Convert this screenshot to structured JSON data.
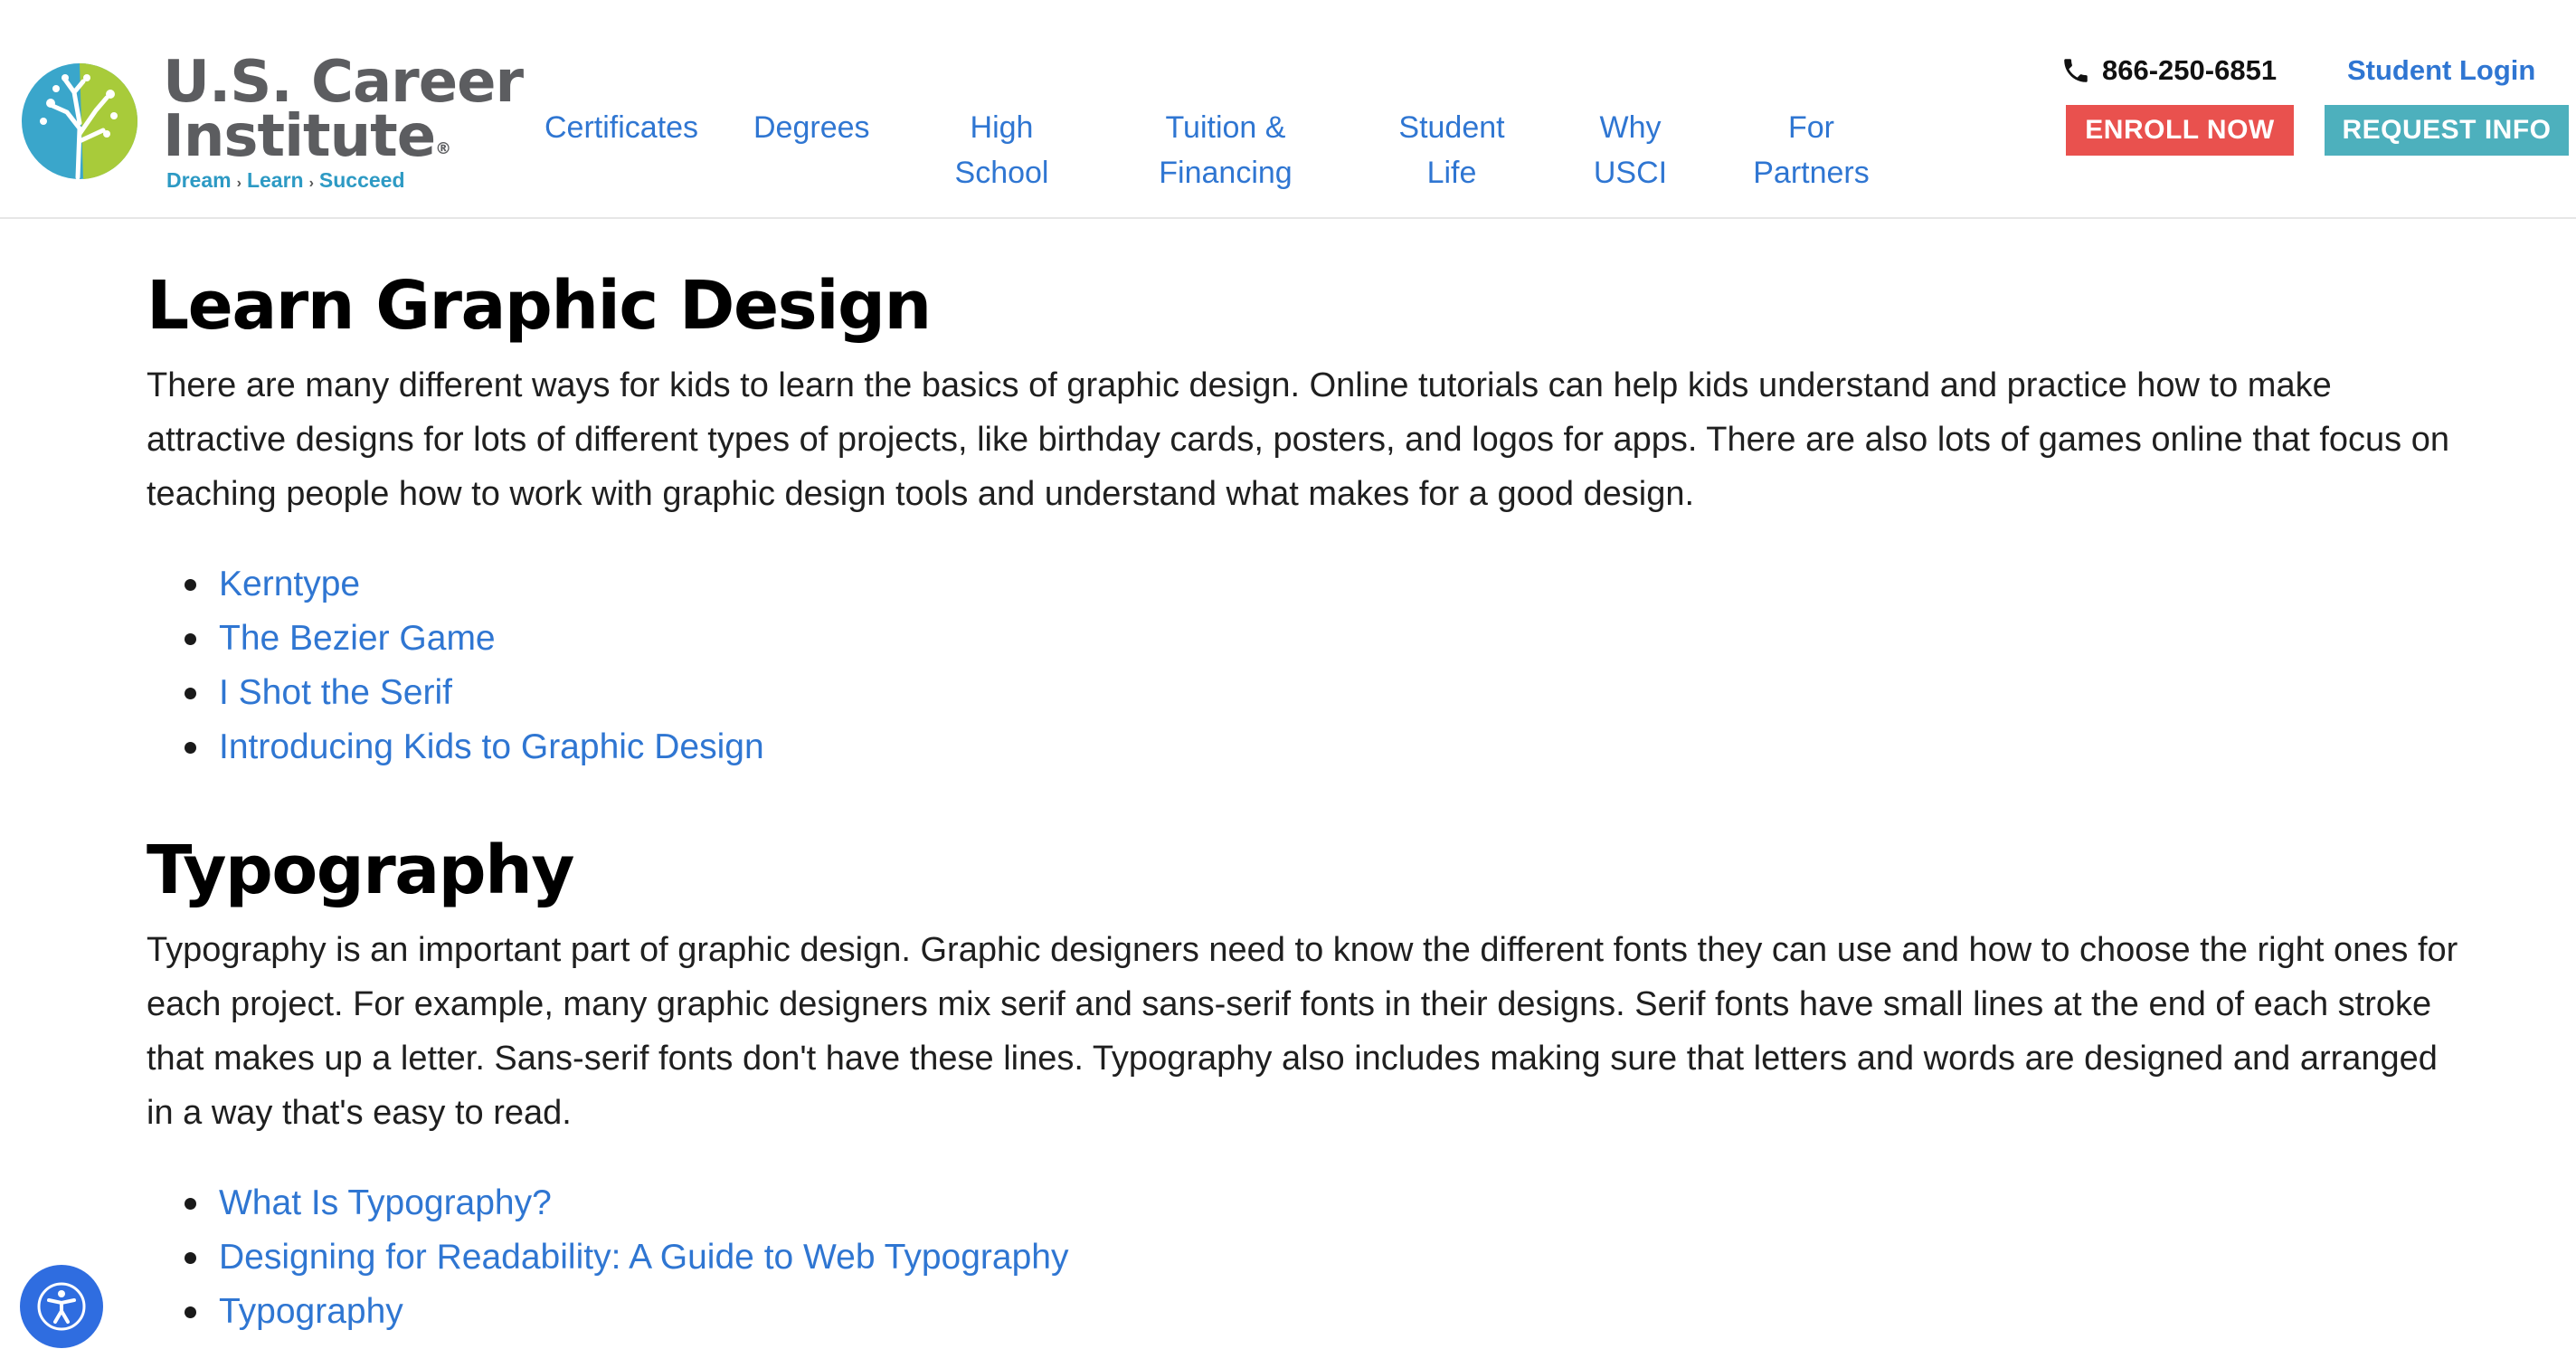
{
  "brand": {
    "line1": "U.S. Career",
    "line2": "Institute",
    "registered": "®",
    "tagline": [
      "Dream",
      "Learn",
      "Succeed"
    ],
    "tagline_sep": "›",
    "colors": {
      "logo_gray": "#5c5d60",
      "logo_blue": "#2d9ac4",
      "logo_green": "#a8cb3a"
    }
  },
  "nav": {
    "items": [
      {
        "lines": [
          "Certificates"
        ]
      },
      {
        "lines": [
          "Degrees"
        ]
      },
      {
        "lines": [
          "High",
          "School"
        ]
      },
      {
        "lines": [
          "Tuition &",
          "Financing"
        ]
      },
      {
        "lines": [
          "Student",
          "Life"
        ]
      },
      {
        "lines": [
          "Why",
          "USCI"
        ]
      },
      {
        "lines": [
          "For",
          "Partners"
        ]
      }
    ],
    "link_color": "#2f76d2"
  },
  "utility": {
    "phone_icon": "phone-icon",
    "phone": "866-250-6851",
    "student_login": "Student Login",
    "enroll": "ENROLL NOW",
    "request": "REQUEST INFO",
    "enroll_color": "#e9514e",
    "request_color": "#4db0bd"
  },
  "sections": [
    {
      "heading": "Learn Graphic Design",
      "paragraph": "There are many different ways for kids to learn the basics of graphic design. Online tutorials can help kids understand and practice how to make attractive designs for lots of different types of projects, like birthday cards, posters, and logos for apps. There are also lots of games online that focus on teaching people how to work with graphic design tools and understand what makes for a good design.",
      "links": [
        "Kerntype",
        "The Bezier Game",
        "I Shot the Serif",
        "Introducing Kids to Graphic Design"
      ]
    },
    {
      "heading": "Typography",
      "paragraph": "Typography is an important part of graphic design. Graphic designers need to know the different fonts they can use and how to choose the right ones for each project. For example, many graphic designers mix serif and sans-serif fonts in their designs. Serif fonts have small lines at the end of each stroke that makes up a letter. Sans-serif fonts don't have these lines. Typography also includes making sure that letters and words are designed and arranged in a way that's easy to read.",
      "links": [
        "What Is Typography?",
        "Designing for Readability: A Guide to Web Typography",
        "Typography"
      ]
    }
  ],
  "accessibility": {
    "icon": "accessibility-icon",
    "color": "#2f6de0"
  }
}
